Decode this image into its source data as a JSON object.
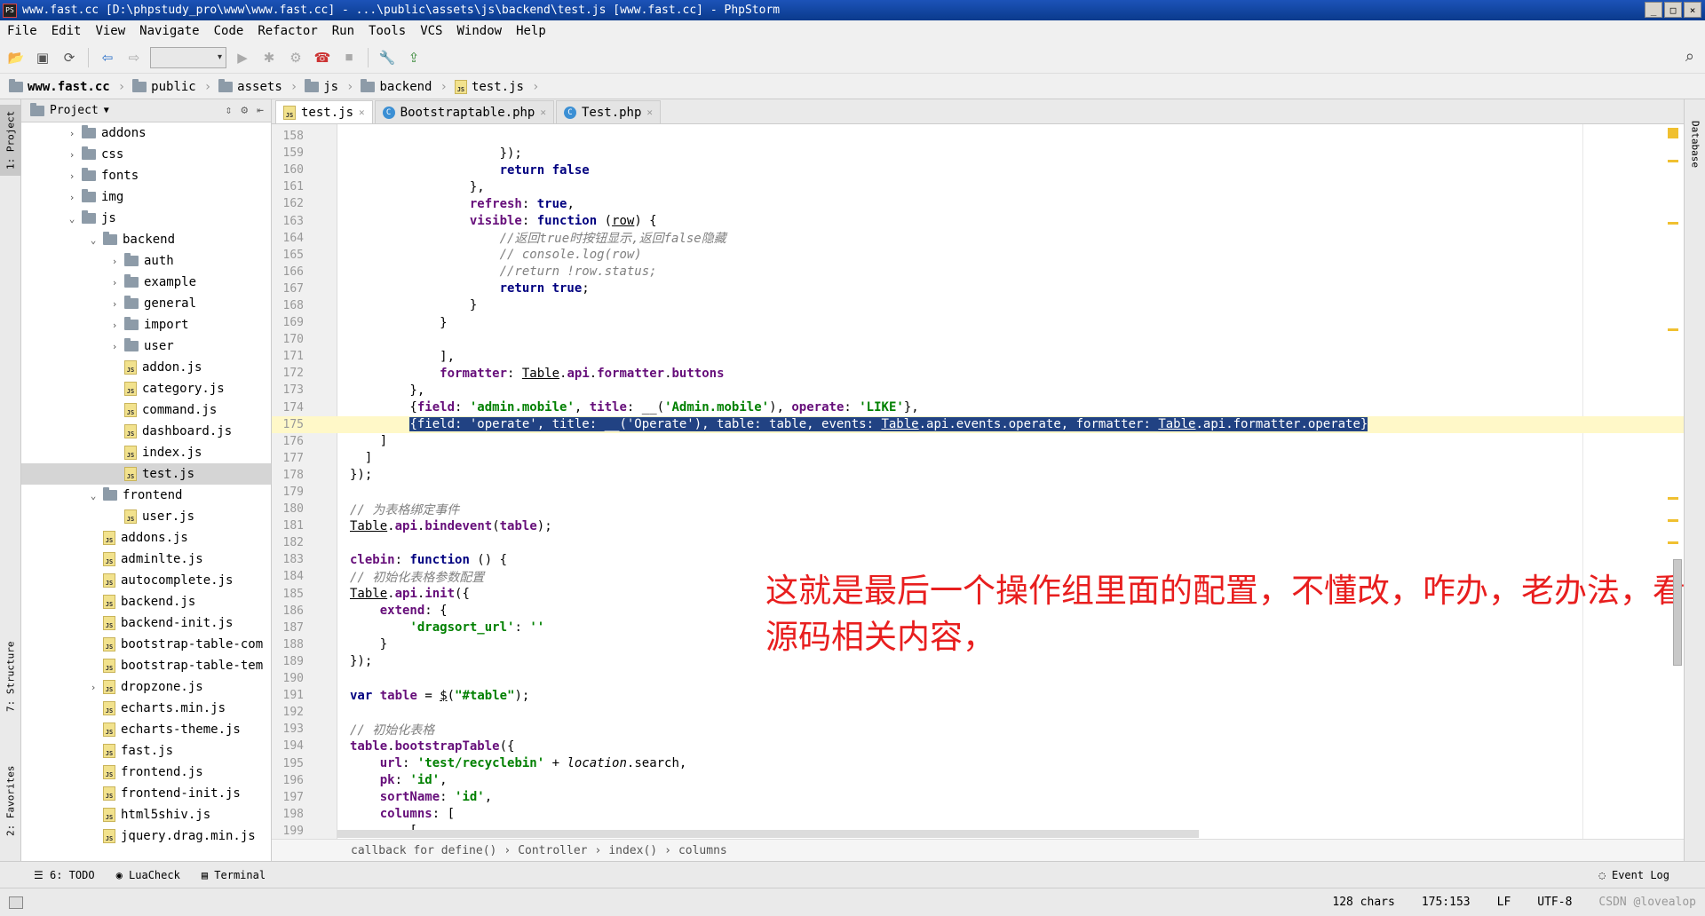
{
  "window": {
    "title": "www.fast.cc [D:\\phpstudy_pro\\www\\www.fast.cc] - ...\\public\\assets\\js\\backend\\test.js [www.fast.cc] - PhpStorm",
    "app_icon": "PS",
    "buttons": [
      "_",
      "□",
      "×"
    ]
  },
  "menu": [
    "File",
    "Edit",
    "View",
    "Navigate",
    "Code",
    "Refactor",
    "Run",
    "Tools",
    "VCS",
    "Window",
    "Help"
  ],
  "breadcrumb": [
    "www.fast.cc",
    "public",
    "assets",
    "js",
    "backend",
    "test.js"
  ],
  "left_strip": {
    "project": "1: Project",
    "structure": "7: Structure",
    "favorites": "2: Favorites"
  },
  "right_strip": {
    "database": "Database"
  },
  "project_panel": {
    "title": "Project",
    "tree": [
      {
        "label": "addons",
        "type": "folder",
        "depth": 0,
        "arrow": "›"
      },
      {
        "label": "css",
        "type": "folder",
        "depth": 0,
        "arrow": "›"
      },
      {
        "label": "fonts",
        "type": "folder",
        "depth": 0,
        "arrow": "›"
      },
      {
        "label": "img",
        "type": "folder",
        "depth": 0,
        "arrow": "›"
      },
      {
        "label": "js",
        "type": "folder",
        "depth": 0,
        "arrow": "⌄"
      },
      {
        "label": "backend",
        "type": "folder",
        "depth": 1,
        "arrow": "⌄"
      },
      {
        "label": "auth",
        "type": "folder",
        "depth": 2,
        "arrow": "›"
      },
      {
        "label": "example",
        "type": "folder",
        "depth": 2,
        "arrow": "›"
      },
      {
        "label": "general",
        "type": "folder",
        "depth": 2,
        "arrow": "›"
      },
      {
        "label": "import",
        "type": "folder",
        "depth": 2,
        "arrow": "›"
      },
      {
        "label": "user",
        "type": "folder",
        "depth": 2,
        "arrow": "›"
      },
      {
        "label": "addon.js",
        "type": "js",
        "depth": 2,
        "arrow": ""
      },
      {
        "label": "category.js",
        "type": "js",
        "depth": 2,
        "arrow": ""
      },
      {
        "label": "command.js",
        "type": "js",
        "depth": 2,
        "arrow": ""
      },
      {
        "label": "dashboard.js",
        "type": "js",
        "depth": 2,
        "arrow": ""
      },
      {
        "label": "index.js",
        "type": "js",
        "depth": 2,
        "arrow": ""
      },
      {
        "label": "test.js",
        "type": "js",
        "depth": 2,
        "arrow": "",
        "selected": true
      },
      {
        "label": "frontend",
        "type": "folder",
        "depth": 1,
        "arrow": "⌄"
      },
      {
        "label": "user.js",
        "type": "js",
        "depth": 2,
        "arrow": ""
      },
      {
        "label": "addons.js",
        "type": "js",
        "depth": 1,
        "arrow": ""
      },
      {
        "label": "adminlte.js",
        "type": "js",
        "depth": 1,
        "arrow": ""
      },
      {
        "label": "autocomplete.js",
        "type": "js",
        "depth": 1,
        "arrow": ""
      },
      {
        "label": "backend.js",
        "type": "js",
        "depth": 1,
        "arrow": ""
      },
      {
        "label": "backend-init.js",
        "type": "js",
        "depth": 1,
        "arrow": ""
      },
      {
        "label": "bootstrap-table-com",
        "type": "js",
        "depth": 1,
        "arrow": ""
      },
      {
        "label": "bootstrap-table-tem",
        "type": "js",
        "depth": 1,
        "arrow": ""
      },
      {
        "label": "dropzone.js",
        "type": "js",
        "depth": 1,
        "arrow": "›"
      },
      {
        "label": "echarts.min.js",
        "type": "js",
        "depth": 1,
        "arrow": ""
      },
      {
        "label": "echarts-theme.js",
        "type": "js",
        "depth": 1,
        "arrow": ""
      },
      {
        "label": "fast.js",
        "type": "js",
        "depth": 1,
        "arrow": ""
      },
      {
        "label": "frontend.js",
        "type": "js",
        "depth": 1,
        "arrow": ""
      },
      {
        "label": "frontend-init.js",
        "type": "js",
        "depth": 1,
        "arrow": ""
      },
      {
        "label": "html5shiv.js",
        "type": "js",
        "depth": 1,
        "arrow": ""
      },
      {
        "label": "jquery.drag.min.js",
        "type": "js",
        "depth": 1,
        "arrow": ""
      }
    ]
  },
  "editor_tabs": [
    {
      "label": "test.js",
      "icon": "js",
      "active": true
    },
    {
      "label": "Bootstraptable.php",
      "icon": "C",
      "active": false
    },
    {
      "label": "Test.php",
      "icon": "C",
      "active": false
    }
  ],
  "code_lines": [
    {
      "n": "158",
      "html": ""
    },
    {
      "n": "159",
      "html": "                    });"
    },
    {
      "n": "160",
      "html": "                    <span class=\"kw\">return false</span>"
    },
    {
      "n": "161",
      "html": "                },"
    },
    {
      "n": "162",
      "html": "                <span class=\"prop\">refresh</span>: <span class=\"kw\">true</span>,"
    },
    {
      "n": "163",
      "html": "                <span class=\"prop\">visible</span>: <span class=\"kw\">function</span> (<u>row</u>) {"
    },
    {
      "n": "164",
      "html": "                    <span class=\"cmt\">//返回true时按钮显示,返回false隐藏</span>"
    },
    {
      "n": "165",
      "html": "                    <span class=\"cmt\">// console.log(row)</span>"
    },
    {
      "n": "166",
      "html": "                    <span class=\"cmt\">//return !row.status;</span>"
    },
    {
      "n": "167",
      "html": "                    <span class=\"kw\">return true</span>;"
    },
    {
      "n": "168",
      "html": "                }"
    },
    {
      "n": "169",
      "html": "            }"
    },
    {
      "n": "170",
      "html": ""
    },
    {
      "n": "171",
      "html": "            ],"
    },
    {
      "n": "172",
      "html": "            <span class=\"prop\">formatter</span>: <u>Table</u>.<span class=\"prop\">api</span>.<span class=\"prop\">formatter</span>.<span class=\"prop\">buttons</span>"
    },
    {
      "n": "173",
      "html": "        },"
    },
    {
      "n": "174",
      "html": "        {<span class=\"prop\">field</span>: <span class=\"str\">'admin.mobile'</span>, <span class=\"prop\">title</span>: __(<span class=\"str\">'Admin.mobile'</span>), <span class=\"prop\">operate</span>: <span class=\"str\">'LIKE'</span>},"
    },
    {
      "n": "175",
      "html": "        <span class=\"selblk\">{field: 'operate', title: __('Operate'), table: table, events: <u>Table</u>.api.events.operate, formatter: <u>Table</u>.api.formatter.operate}</span>",
      "hl": true
    },
    {
      "n": "176",
      "html": "    ]"
    },
    {
      "n": "177",
      "html": "  ]"
    },
    {
      "n": "178",
      "html": "});"
    },
    {
      "n": "179",
      "html": ""
    },
    {
      "n": "180",
      "html": "<span class=\"cmt\">// 为表格绑定事件</span>"
    },
    {
      "n": "181",
      "html": "<u>Table</u>.<span class=\"prop\">api</span>.<span class=\"prop\">bindevent</span>(<span class=\"prop\">table</span>);"
    },
    {
      "n": "182",
      "html": ""
    },
    {
      "n": "183",
      "html": "<span class=\"prop\">clebin</span>: <span class=\"kw\">function</span> () {"
    },
    {
      "n": "184",
      "html": "<span class=\"cmt\">// 初始化表格参数配置</span>"
    },
    {
      "n": "185",
      "html": "<u>Table</u>.<span class=\"prop\">api</span>.<span class=\"prop\">init</span>({"
    },
    {
      "n": "186",
      "html": "    <span class=\"prop\">extend</span>: {"
    },
    {
      "n": "187",
      "html": "        <span class=\"str\">'dragsort_url'</span>: <span class=\"str\">''</span>"
    },
    {
      "n": "188",
      "html": "    }"
    },
    {
      "n": "189",
      "html": "});"
    },
    {
      "n": "190",
      "html": ""
    },
    {
      "n": "191",
      "html": "<span class=\"kw\">var</span> <span class=\"prop\">table</span> = <u>$</u>(<span class=\"str\">\"#table\"</span>);"
    },
    {
      "n": "192",
      "html": ""
    },
    {
      "n": "193",
      "html": "<span class=\"cmt\">// 初始化表格</span>"
    },
    {
      "n": "194",
      "html": "<span class=\"prop\">table</span>.<span class=\"prop\">bootstrapTable</span>({"
    },
    {
      "n": "195",
      "html": "    <span class=\"prop\">url</span>: <span class=\"str\">'test/recyclebin'</span> + <i>location</i>.search,"
    },
    {
      "n": "196",
      "html": "    <span class=\"prop\">pk</span>: <span class=\"str\">'id'</span>,"
    },
    {
      "n": "197",
      "html": "    <span class=\"prop\">sortName</span>: <span class=\"str\">'id'</span>,"
    },
    {
      "n": "198",
      "html": "    <span class=\"prop\">columns</span>: ["
    },
    {
      "n": "199",
      "html": "        ["
    }
  ],
  "overlay_text": [
    "这就是最后一个操作组里面的配置，不懂改，咋办，老办法，看自带的",
    "源码相关内容，"
  ],
  "editor_breadcrumb": [
    "callback for define()",
    "Controller",
    "index()",
    "columns"
  ],
  "bottom_tabs": [
    "6: TODO",
    "LuaCheck",
    "Terminal"
  ],
  "event_log": "Event Log",
  "status": {
    "chars": "128 chars",
    "position": "175:153",
    "line_sep": "LF",
    "encoding": "UTF-8",
    "watermark": "CSDN @lovealop"
  },
  "colors": {
    "title_bar": "#1c53b8",
    "selection": "#214283",
    "overlay": "#e81e1e",
    "keyword": "#000080",
    "string": "#008000"
  }
}
